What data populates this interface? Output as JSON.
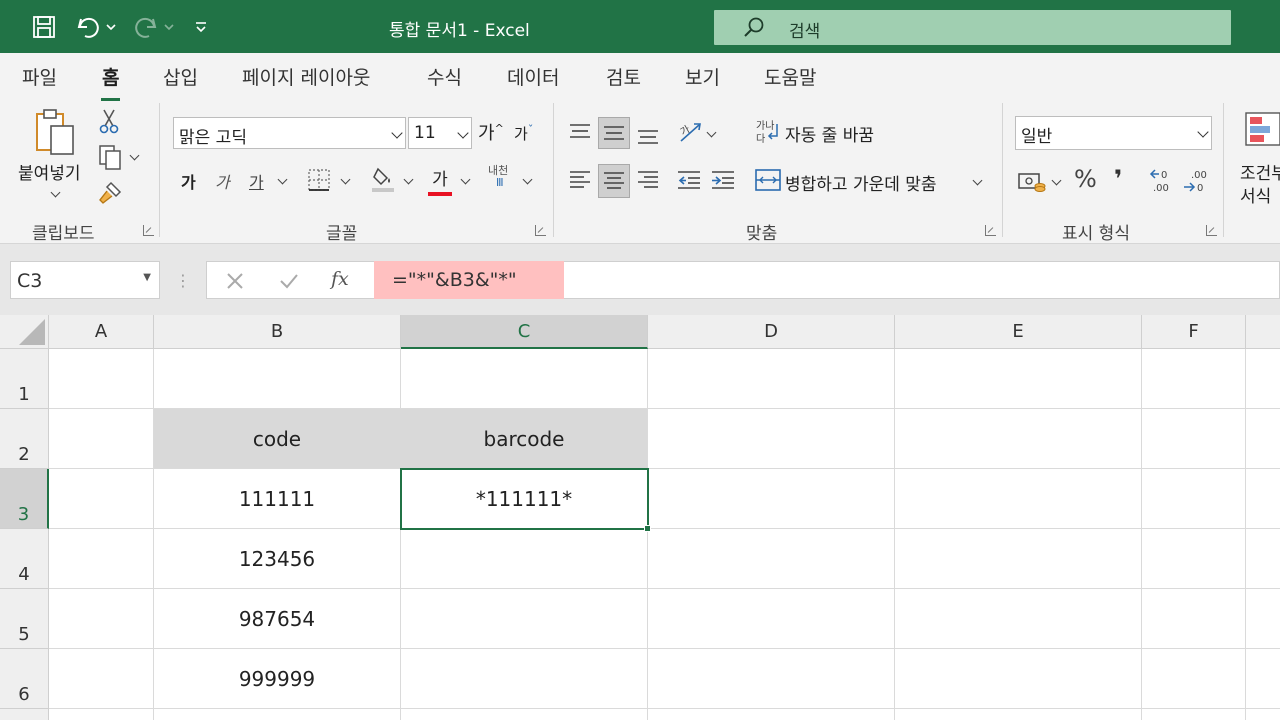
{
  "titlebar": {
    "doc_title": "통합 문서1  -  Excel",
    "search_placeholder": "검색"
  },
  "tabs": [
    "파일",
    "홈",
    "삽입",
    "페이지 레이아웃",
    "수식",
    "데이터",
    "검토",
    "보기",
    "도움말"
  ],
  "active_tab": "홈",
  "ribbon": {
    "clipboard": {
      "paste_label": "붙여넣기",
      "group_label": "클립보드"
    },
    "font": {
      "font_name": "맑은 고딕",
      "font_size": "11",
      "grow_label": "가",
      "shrink_label": "가",
      "bold_label": "가",
      "italic_label": "가",
      "underline_label": "가",
      "font_color_label": "가",
      "phonetic_label": "내천",
      "group_label": "글꼴"
    },
    "alignment": {
      "wrap_text": "자동 줄 바꿈",
      "merge_center": "병합하고 가운데 맞춤",
      "wrap_icon_text": "가나다",
      "group_label": "맞춤"
    },
    "number": {
      "format": "일반",
      "percent": "%",
      "comma": "❜",
      "group_label": "표시 형식"
    },
    "styles": {
      "conditional_label_1": "조건부",
      "conditional_label_2": "서식"
    }
  },
  "formula_bar": {
    "name_box": "C3",
    "fx": "fx",
    "formula": "=\"*\"&B3&\"*\""
  },
  "sheet": {
    "columns": [
      "A",
      "B",
      "C",
      "D",
      "E",
      "F"
    ],
    "rows": [
      "1",
      "2",
      "3",
      "4",
      "5",
      "6"
    ],
    "cells": {
      "B2": "code",
      "C2": "barcode",
      "B3": "111111",
      "C3": "*111111*",
      "B4": "123456",
      "B5": "987654",
      "B6": "999999"
    },
    "active_cell": "C3"
  },
  "colors": {
    "accent": "#217346",
    "formula_highlight": "#ffc0c0",
    "header_fill": "#d9d9d9"
  }
}
